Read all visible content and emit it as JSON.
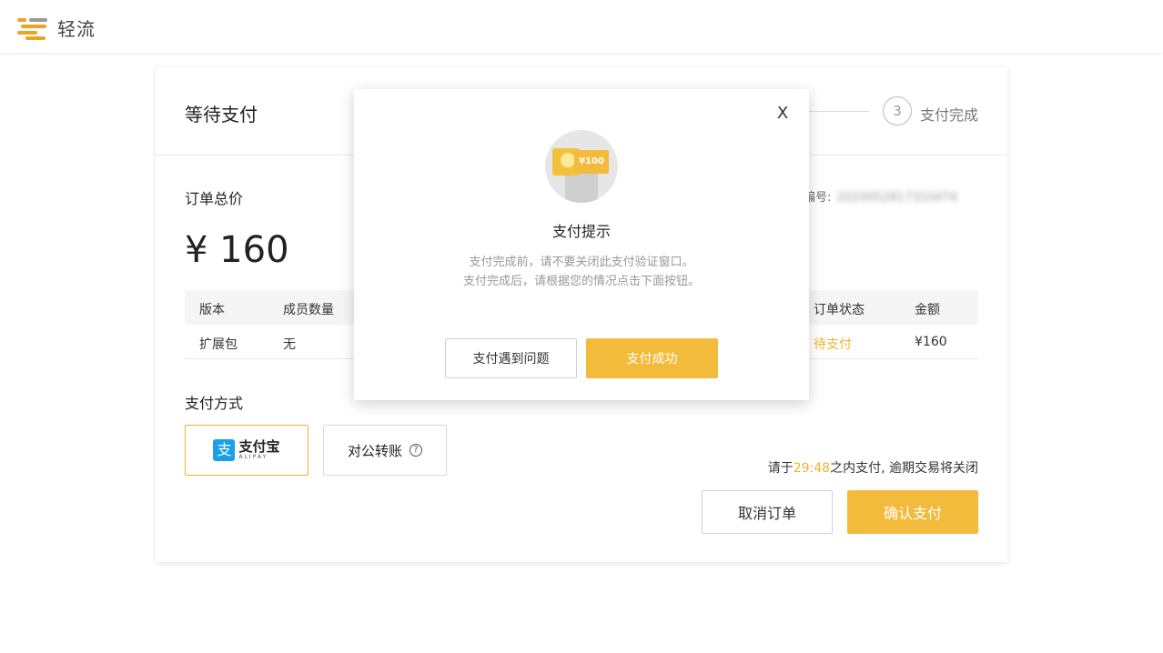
{
  "header": {
    "app_name": "轻流",
    "brand_color": "#e8a623"
  },
  "card": {
    "title": "等待支付",
    "step": {
      "number": "3",
      "label": "支付完成"
    },
    "order_total_label": "订单总价",
    "order_number_label": "编号:",
    "order_number_value": "2020052817310474",
    "price": "¥ 160",
    "table": {
      "headers": [
        "版本",
        "成员数量",
        "订单状态",
        "金额"
      ],
      "rows": [
        {
          "version": "扩展包",
          "members": "无",
          "status": "待支付",
          "amount": "¥160"
        }
      ]
    },
    "payment_method_label": "支付方式",
    "payment_methods": {
      "alipay": {
        "icon": "alipay-icon",
        "glyph": "支",
        "name": "支付宝",
        "subname": "ALIPAY"
      },
      "transfer": {
        "label": "对公转账",
        "help_glyph": "?"
      }
    },
    "countdown": {
      "prefix": "请于",
      "time": "29:48",
      "suffix": "之内支付, 逾期交易将关闭"
    },
    "cancel_button": "取消订单",
    "confirm_button": "确认支付",
    "accent_color": "#f3bb3b"
  },
  "modal": {
    "close_glyph": "X",
    "illustration_text": "¥100",
    "title": "支付提示",
    "desc_line1": "支付完成前，请不要关闭此支付验证窗口。",
    "desc_line2": "支付完成后，请根据您的情况点击下面按钮。",
    "problem_button": "支付遇到问题",
    "success_button": "支付成功"
  }
}
